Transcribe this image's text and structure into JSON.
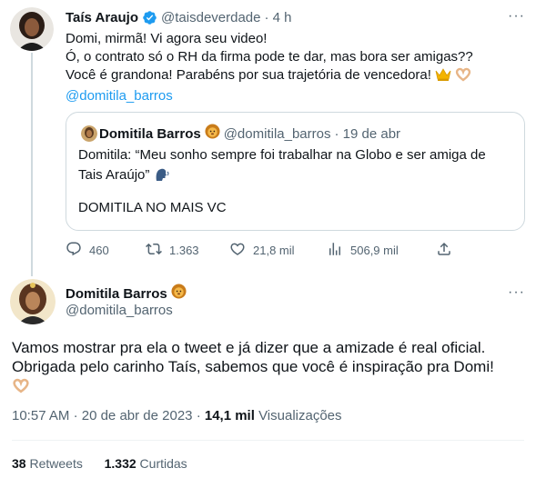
{
  "quoted_tweet_author": {
    "name": "Taís Araujo",
    "handle": "@taisdeverdade",
    "time": "· 4 h"
  },
  "quoted_tweet": {
    "lines": [
      "Domi, mirmã! Vi agora seu video!",
      "Ó, o contrato só o RH da firma pode te dar, mas bora ser amigas??",
      "Você é grandona! Parabéns por sua trajetória de vencedora!"
    ],
    "mention": "@domitila_barros"
  },
  "embedded_quote": {
    "name": "Domitila Barros",
    "handle": "@domitila_barros",
    "date": "· 19 de abr",
    "lines": [
      "Domitila: “Meu sonho sempre foi trabalhar na Globo e ser amiga de",
      "Tais Araújo”"
    ],
    "footer": "DOMITILA NO MAIS VC"
  },
  "actions": {
    "replies": "460",
    "retweets": "1.363",
    "likes": "21,8 mil",
    "views": "506,9 mil"
  },
  "main_tweet": {
    "name": "Domitila Barros",
    "handle": "@domitila_barros",
    "lines": [
      "Vamos mostrar pra ela o tweet e já dizer que a amizade é real oficial.",
      "Obrigada pelo carinho Taís, sabemos que você é inspiração pra Domi!"
    ],
    "time": "10:57 AM",
    "dot": "·",
    "date": "20 de abr de 2023",
    "views_count": "14,1 mil",
    "views_label": "Visualizações"
  },
  "engagement": {
    "retweets_count": "38",
    "retweets_label": "Retweets",
    "likes_count": "1.332",
    "likes_label": "Curtidas"
  },
  "colors": {
    "verified": "#1d9bf0",
    "link": "#1d9bf0",
    "muted": "#536471",
    "border": "#cfd9de"
  },
  "icons": [
    "verified-badge-icon",
    "lion-emoji-icon",
    "crown-emoji-icon",
    "heart-hands-emoji-icon",
    "speaking-head-emoji-icon",
    "reply-icon",
    "retweet-icon",
    "like-icon",
    "views-icon",
    "share-icon",
    "more-icon"
  ]
}
